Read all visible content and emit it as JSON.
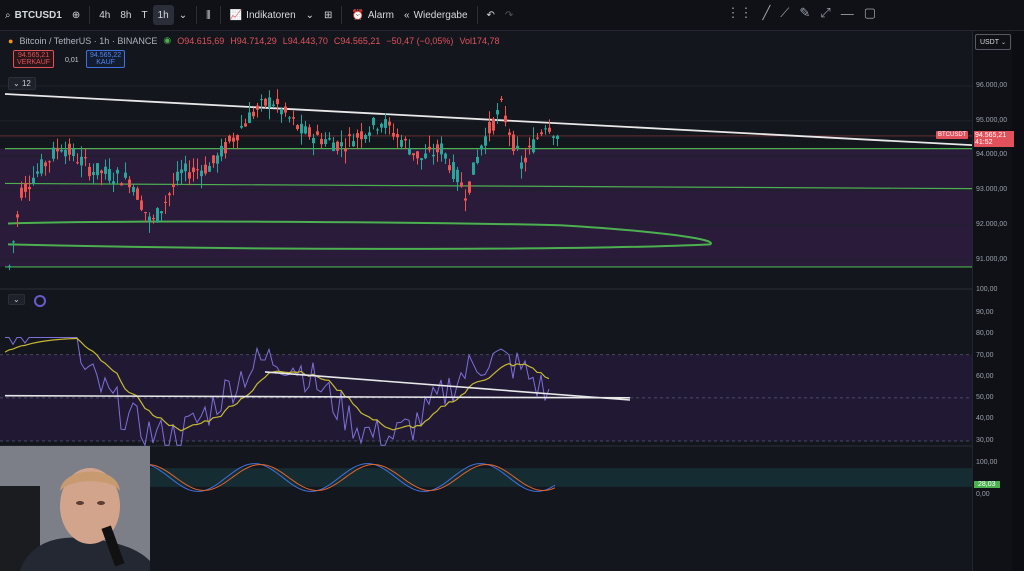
{
  "toolbar": {
    "symbol": "BTCUSD1",
    "intervals": [
      "4h",
      "8h",
      "T",
      "1h"
    ],
    "indicators_label": "Indikatoren",
    "alarm_label": "Alarm",
    "replay_label": "Wiedergabe"
  },
  "legend": {
    "pair": "Bitcoin / TetherUS · 1h · BINANCE",
    "open": "O94.615,69",
    "high": "H94.714,29",
    "low": "L94.443,70",
    "close": "C94.565,21",
    "change": "−50,47 (−0,05%)",
    "volume": "Vol174,78"
  },
  "order": {
    "sell_price": "94.565,21",
    "sell_label": "VERKAUF",
    "spread": "0,01",
    "buy_price": "94.565,22",
    "buy_label": "KAUF"
  },
  "indicator_count": "12",
  "axis": {
    "currency": "USDT",
    "price_ticks": [
      "96.000,00",
      "95.000,00",
      "94.000,00",
      "93.000,00",
      "92.000,00",
      "91.000,00"
    ],
    "current_badge_symbol": "BTCUSDT",
    "current_badge_price": "94.565,21",
    "current_badge_time": "41:52",
    "rsi_ticks": [
      "100,00",
      "90,00",
      "80,00",
      "70,00",
      "60,00",
      "50,00",
      "40,00",
      "30,00"
    ],
    "stoch_ticks": [
      "100,00",
      "0,00"
    ],
    "stoch_value": "28,03"
  },
  "colors": {
    "up": "#26a69a",
    "down": "#ef5350",
    "zone": "#3a2150",
    "trendline": "#e8e8e8",
    "levels": "#4caf50",
    "rsi": "#7e6fd9",
    "rsi_ma": "#c6b832"
  }
}
